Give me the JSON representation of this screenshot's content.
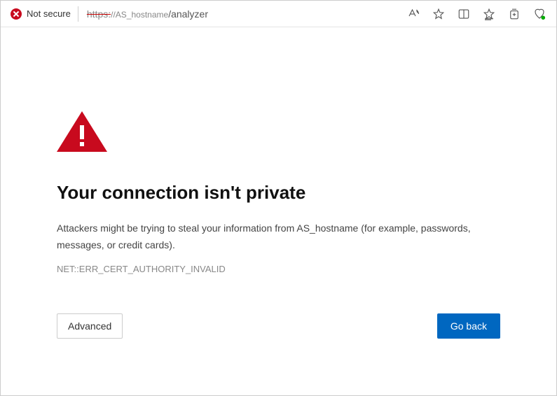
{
  "addressBar": {
    "securityLabel": "Not secure",
    "urlProtocol": "https:",
    "urlSlashes": "//",
    "urlHost": "AS_hostname",
    "urlPath": "/analyzer"
  },
  "warning": {
    "title": "Your connection isn't private",
    "descriptionPrefix": "Attackers might be trying to steal your information from ",
    "descriptionHost": "AS_hostname",
    "descriptionSuffix": " (for example, passwords, messages, or credit cards).",
    "errorCode": "NET::ERR_CERT_AUTHORITY_INVALID"
  },
  "buttons": {
    "advanced": "Advanced",
    "goBack": "Go back"
  }
}
